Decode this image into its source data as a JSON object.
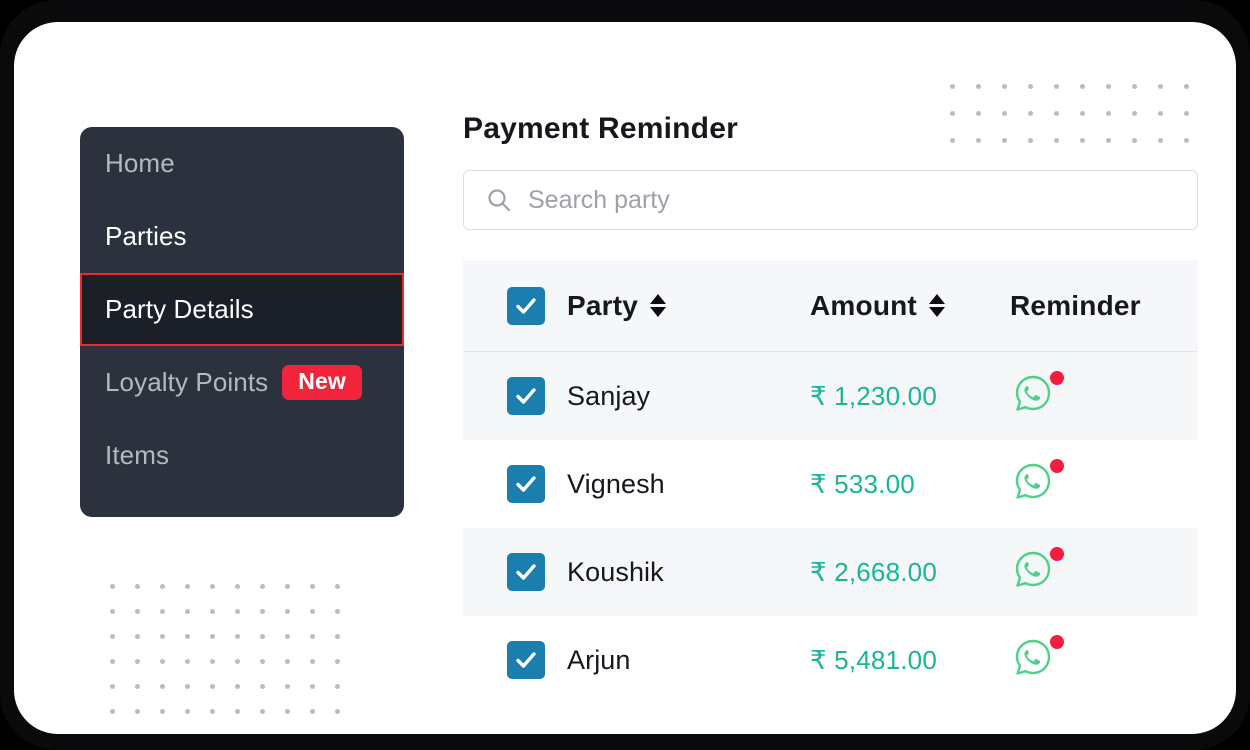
{
  "sidebar": {
    "items": [
      {
        "label": "Home",
        "state": "muted",
        "badge": null
      },
      {
        "label": "Parties",
        "state": "bright",
        "badge": null
      },
      {
        "label": "Party Details",
        "state": "active",
        "badge": null
      },
      {
        "label": "Loyalty Points",
        "state": "muted",
        "badge": "New"
      },
      {
        "label": "Items",
        "state": "muted",
        "badge": null
      }
    ],
    "highlight_color": "#f0282d",
    "background_color": "#2b323d"
  },
  "main": {
    "title": "Payment Reminder",
    "search": {
      "placeholder": "Search party",
      "value": "",
      "icon": "search-icon"
    },
    "table": {
      "columns": [
        {
          "label": "Party",
          "sortable": true
        },
        {
          "label": "Amount",
          "sortable": true
        },
        {
          "label": "Reminder",
          "sortable": false
        }
      ],
      "header_checkbox_checked": true,
      "rows": [
        {
          "checked": true,
          "party": "Sanjay",
          "amount": "₹ 1,230.00",
          "reminder_icon": "whatsapp-icon",
          "reminder_badge": true
        },
        {
          "checked": true,
          "party": "Vignesh",
          "amount": "₹ 533.00",
          "reminder_icon": "whatsapp-icon",
          "reminder_badge": true
        },
        {
          "checked": true,
          "party": "Koushik",
          "amount": "₹ 2,668.00",
          "reminder_icon": "whatsapp-icon",
          "reminder_badge": true
        },
        {
          "checked": true,
          "party": "Arjun",
          "amount": "₹ 5,481.00",
          "reminder_icon": "whatsapp-icon",
          "reminder_badge": true
        }
      ]
    },
    "colors": {
      "amount": "#18b794",
      "checkbox": "#1a7fae",
      "whatsapp": "#4fd18b",
      "badge": "#f41c3f"
    }
  },
  "decor": {
    "dots_top_right": {
      "cols": 10,
      "rows": 3,
      "color": "#b9bcc4"
    },
    "dots_bottom_left": {
      "cols": 10,
      "rows": 6,
      "color": "#b9bcc4"
    }
  }
}
